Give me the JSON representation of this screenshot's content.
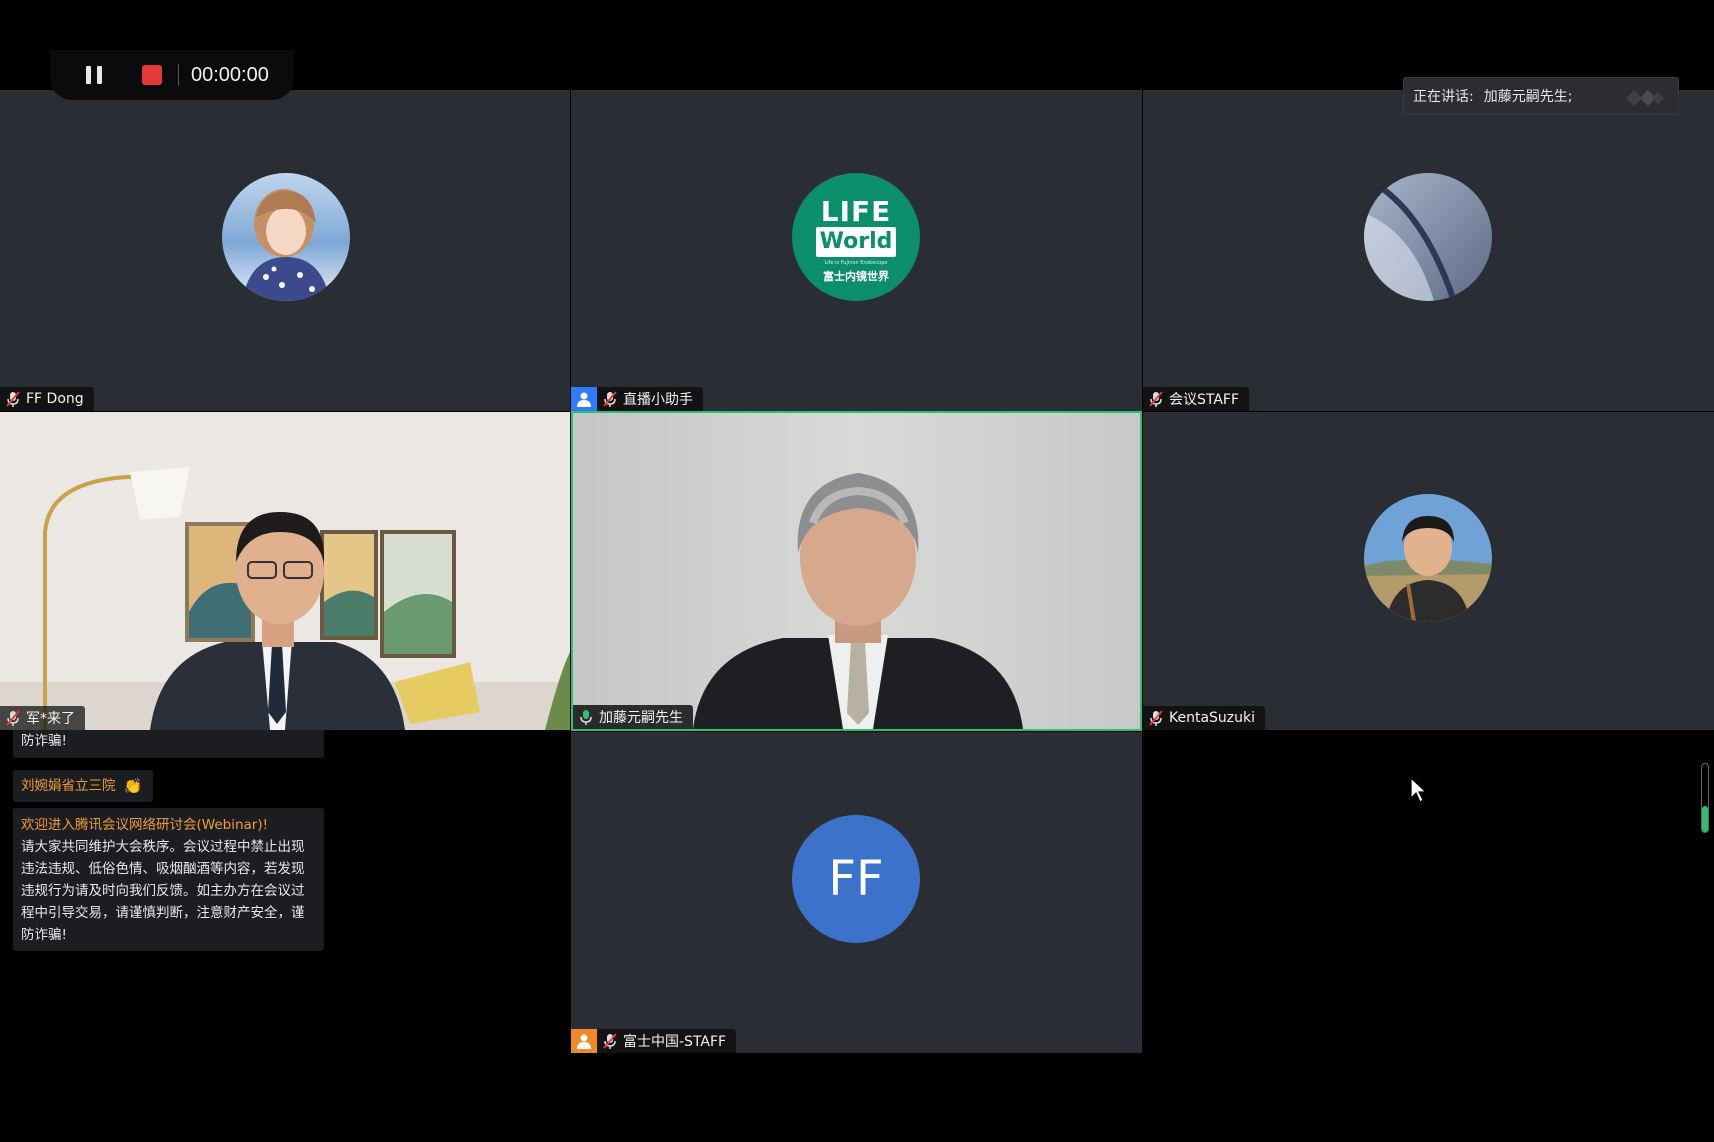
{
  "toolbar": {
    "timer": "00:00:00",
    "pause_icon": "pause-icon",
    "stop_icon": "stop-record-icon"
  },
  "speaking": {
    "label": "正在讲话:",
    "name": "加藤元嗣先生;"
  },
  "participants": [
    {
      "name": "FF Dong",
      "mic": "muted",
      "avatar": "photo-girl"
    },
    {
      "name": "直播小助手",
      "mic": "muted",
      "avatar": "lifeworld-logo",
      "role": "host"
    },
    {
      "name": "会议STAFF",
      "mic": "muted",
      "avatar": "photo-abstract"
    },
    {
      "name": "军*来了",
      "mic": "muted",
      "avatar": "video"
    },
    {
      "name": "加藤元嗣先生",
      "mic": "active",
      "avatar": "video",
      "speaking": true
    },
    {
      "name": "KentaSuzuki",
      "mic": "muted",
      "avatar": "photo-man"
    },
    {
      "name": "富士中国-STAFF",
      "mic": "muted",
      "avatar": "FF",
      "role": "co-host"
    }
  ],
  "logo": {
    "line1": "LIFE",
    "line2": "World",
    "sub1": "Life is Fujinon Endoscope",
    "sub2": "富士内镜世界"
  },
  "ff_avatar_text": "FF",
  "chat": {
    "prev_tail": "防诈骗!",
    "msg1_name": "刘婉娟省立三院",
    "msg1_emoji": "👏",
    "welcome_title": "欢迎进入腾讯会议网络研讨会(Webinar)!",
    "welcome_lines": [
      "请大家共同维护大会秩序。会议过程中禁止出现",
      "违法违规、低俗色情、吸烟酗酒等内容，若发现",
      "违规行为请及时向我们反馈。如主办方在会议过",
      "程中引导交易，请谨慎判断，注意财产安全，谨",
      "防诈骗!"
    ]
  },
  "colors": {
    "tile_bg": "#2a2d33",
    "active_border": "#2fbf71",
    "stop_red": "#e53935",
    "ff_blue": "#3a73c9",
    "logo_green": "#0b8e6b",
    "chat_orange": "#f29c38"
  }
}
